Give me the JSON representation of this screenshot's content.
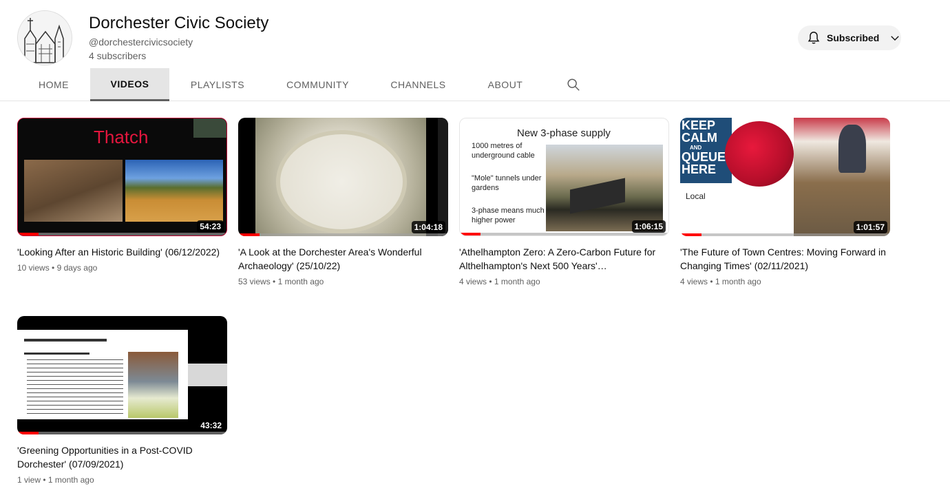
{
  "channel": {
    "name": "Dorchester Civic Society",
    "handle": "@dorchestercivicsociety",
    "subscribers": "4 subscribers",
    "subscribe_label": "Subscribed",
    "subscribe_icon": "bell-icon",
    "dropdown_icon": "chevron-down-icon"
  },
  "tabs": [
    {
      "label": "HOME",
      "active": false
    },
    {
      "label": "VIDEOS",
      "active": true
    },
    {
      "label": "PLAYLISTS",
      "active": false
    },
    {
      "label": "COMMUNITY",
      "active": false
    },
    {
      "label": "CHANNELS",
      "active": false
    },
    {
      "label": "ABOUT",
      "active": false
    }
  ],
  "search_icon": "search-icon",
  "videos": [
    {
      "title": "'Looking After an Historic Building' (06/12/2022)",
      "duration": "54:23",
      "views": "10 views",
      "age": "9 days ago",
      "progress": 0.1,
      "thumb_text": "Thatch"
    },
    {
      "title": "'A Look at the Dorchester Area's Wonderful Archaeology' (25/10/22)",
      "duration": "1:04:18",
      "views": "53 views",
      "age": "1 month ago",
      "progress": 0.1
    },
    {
      "title": "'Athelhampton Zero: A Zero-Carbon Future for Althelhampton's Next 500 Years'…",
      "duration": "1:06:15",
      "views": "4 views",
      "age": "1 month ago",
      "progress": 0.1,
      "thumb_heading": "New 3-phase supply",
      "thumb_bullets": [
        "1000 metres of underground cable",
        "\"Mole\" tunnels under gardens",
        "3-phase means much higher power"
      ]
    },
    {
      "title": "'The Future of Town Centres: Moving Forward in Changing Times' (02/11/2021)",
      "duration": "1:01:57",
      "views": "4 views",
      "age": "1 month ago",
      "progress": 0.1,
      "thumb_lines": [
        "KEEP",
        "CALM",
        "AND",
        "QUEUE",
        "HERE"
      ],
      "thumb_local": "Local"
    },
    {
      "title": "'Greening Opportunities in a Post-COVID Dorchester' (07/09/2021)",
      "duration": "43:32",
      "views": "1 view",
      "age": "1 month ago",
      "progress": 0.1
    }
  ],
  "meta_separator": "•"
}
